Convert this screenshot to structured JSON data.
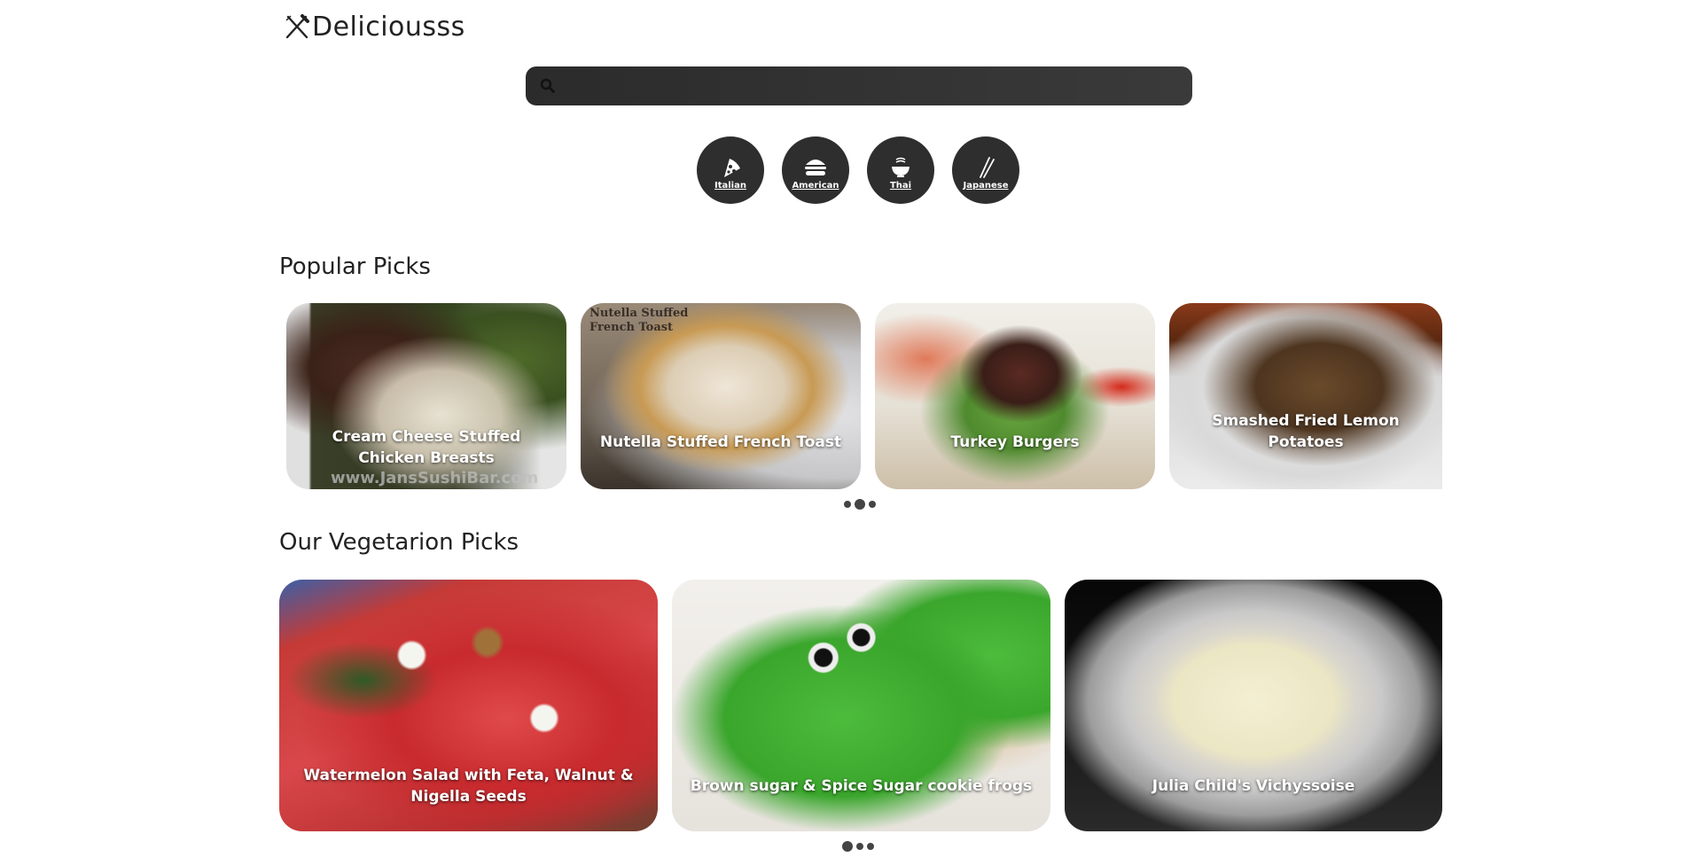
{
  "app": {
    "logo_text": "Deliciousss"
  },
  "search": {
    "placeholder": ""
  },
  "cuisines": [
    {
      "label": "Italian",
      "icon": "pizza-icon"
    },
    {
      "label": "American",
      "icon": "burger-icon"
    },
    {
      "label": "Thai",
      "icon": "noodle-bowl-icon"
    },
    {
      "label": "Japanese",
      "icon": "chopsticks-icon"
    }
  ],
  "popular": {
    "title": "Popular Picks",
    "cards": [
      {
        "label": "Cream Cheese Stuffed Chicken Breasts",
        "image_text": "www.JansSushiBar.com"
      },
      {
        "label": "Nutella Stuffed French Toast",
        "image_text": "Nutella Stuffed\nFrench Toast"
      },
      {
        "label": "Turkey Burgers"
      },
      {
        "label": "Smashed Fried Lemon Potatoes"
      }
    ],
    "pagination": {
      "count": 3,
      "active": 2
    }
  },
  "vegetarian": {
    "title": "Our Vegetarion Picks",
    "cards": [
      {
        "label": "Watermelon Salad with Feta, Walnut & Nigella Seeds"
      },
      {
        "label": "Brown sugar & Spice Sugar cookie frogs"
      },
      {
        "label": "Julia Child's Vichyssoise"
      }
    ],
    "pagination": {
      "count": 3,
      "active": 1
    }
  }
}
